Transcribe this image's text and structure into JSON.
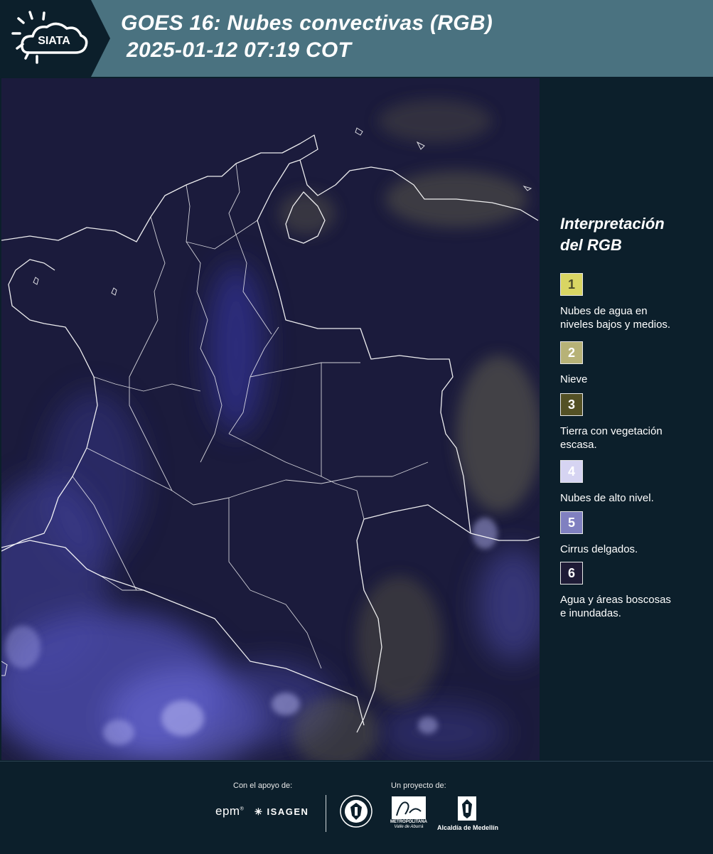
{
  "header": {
    "logo_text": "SIATA",
    "title_line1": "GOES 16: Nubes convectivas (RGB)",
    "title_line2": "2025-01-12 07:19 COT"
  },
  "map": {
    "product": "satellite-rgb-convective-clouds",
    "region": "Colombia"
  },
  "legend": {
    "title_line1": "Interpretación",
    "title_line2": "del RGB",
    "items": [
      {
        "number": "1",
        "color": "#d9d563",
        "text_color": "#4a4a2a",
        "label_line1": "Nubes de agua en",
        "label_line2": "niveles bajos y medios."
      },
      {
        "number": "2",
        "color": "#b7b277",
        "text_color": "#ffffff",
        "label_line1": "Nieve",
        "label_line2": ""
      },
      {
        "number": "3",
        "color": "#545125",
        "text_color": "#ffffff",
        "label_line1": "Tierra con vegetación",
        "label_line2": "escasa."
      },
      {
        "number": "4",
        "color": "#d6d4f2",
        "text_color": "#ffffff",
        "label_line1": "Nubes de alto nivel.",
        "label_line2": ""
      },
      {
        "number": "5",
        "color": "#8080c0",
        "text_color": "#ffffff",
        "label_line1": "Cirrus delgados.",
        "label_line2": ""
      },
      {
        "number": "6",
        "color": "#1e1b36",
        "text_color": "#ffffff",
        "label_line1": "Agua y áreas boscosas",
        "label_line2": "e inundadas."
      }
    ]
  },
  "footer": {
    "support_label": "Con el apoyo de:",
    "project_label": "Un proyecto de:",
    "sponsor1": "epm",
    "sponsor2": "ISAGEN",
    "partner_area_caption1": "METROPOLITANA",
    "partner_area_caption2": "Valle de Aburrá",
    "partner_alcaldia": "Alcaldía de Medellín"
  }
}
